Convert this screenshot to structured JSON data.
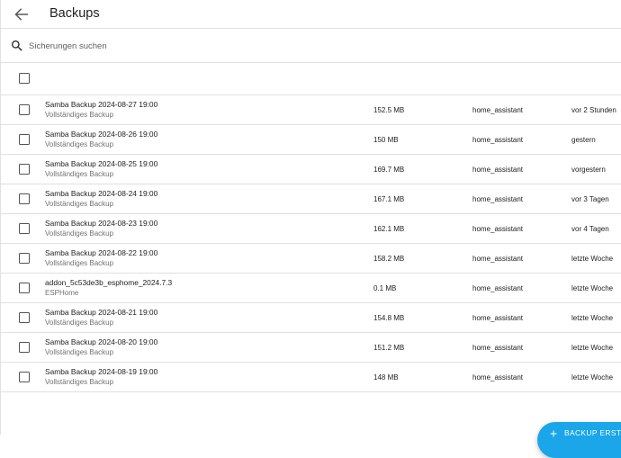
{
  "header": {
    "title": "Backups",
    "back_icon": "arrow-left-icon"
  },
  "search": {
    "placeholder": "Sicherungen suchen",
    "value": ""
  },
  "backups": [
    {
      "name": "Samba Backup 2024-08-27 19:00",
      "type": "Vollständiges Backup",
      "size": "152.5 MB",
      "location": "home_assistant",
      "date": "vor 2 Stunden"
    },
    {
      "name": "Samba Backup 2024-08-26 19:00",
      "type": "Vollständiges Backup",
      "size": "150 MB",
      "location": "home_assistant",
      "date": "gestern"
    },
    {
      "name": "Samba Backup 2024-08-25 19:00",
      "type": "Vollständiges Backup",
      "size": "169.7 MB",
      "location": "home_assistant",
      "date": "vorgestern"
    },
    {
      "name": "Samba Backup 2024-08-24 19:00",
      "type": "Vollständiges Backup",
      "size": "167.1 MB",
      "location": "home_assistant",
      "date": "vor 3 Tagen"
    },
    {
      "name": "Samba Backup 2024-08-23 19:00",
      "type": "Vollständiges Backup",
      "size": "162.1 MB",
      "location": "home_assistant",
      "date": "vor 4 Tagen"
    },
    {
      "name": "Samba Backup 2024-08-22 19:00",
      "type": "Vollständiges Backup",
      "size": "158.2 MB",
      "location": "home_assistant",
      "date": "letzte Woche"
    },
    {
      "name": "addon_5c53de3b_esphome_2024.7.3",
      "type": "ESPHome",
      "size": "0.1 MB",
      "location": "home_assistant",
      "date": "letzte Woche"
    },
    {
      "name": "Samba Backup 2024-08-21 19:00",
      "type": "Vollständiges Backup",
      "size": "154.8 MB",
      "location": "home_assistant",
      "date": "letzte Woche"
    },
    {
      "name": "Samba Backup 2024-08-20 19:00",
      "type": "Vollständiges Backup",
      "size": "151.2 MB",
      "location": "home_assistant",
      "date": "letzte Woche"
    },
    {
      "name": "Samba Backup 2024-08-19 19:00",
      "type": "Vollständiges Backup",
      "size": "148 MB",
      "location": "home_assistant",
      "date": "letzte Woche"
    }
  ],
  "fab": {
    "label": "BACKUP ERSTELLEN",
    "icon": "plus-icon"
  },
  "colors": {
    "accent": "#1aa6e8",
    "divider": "#e0e0e0",
    "secondary_text": "#727272"
  }
}
